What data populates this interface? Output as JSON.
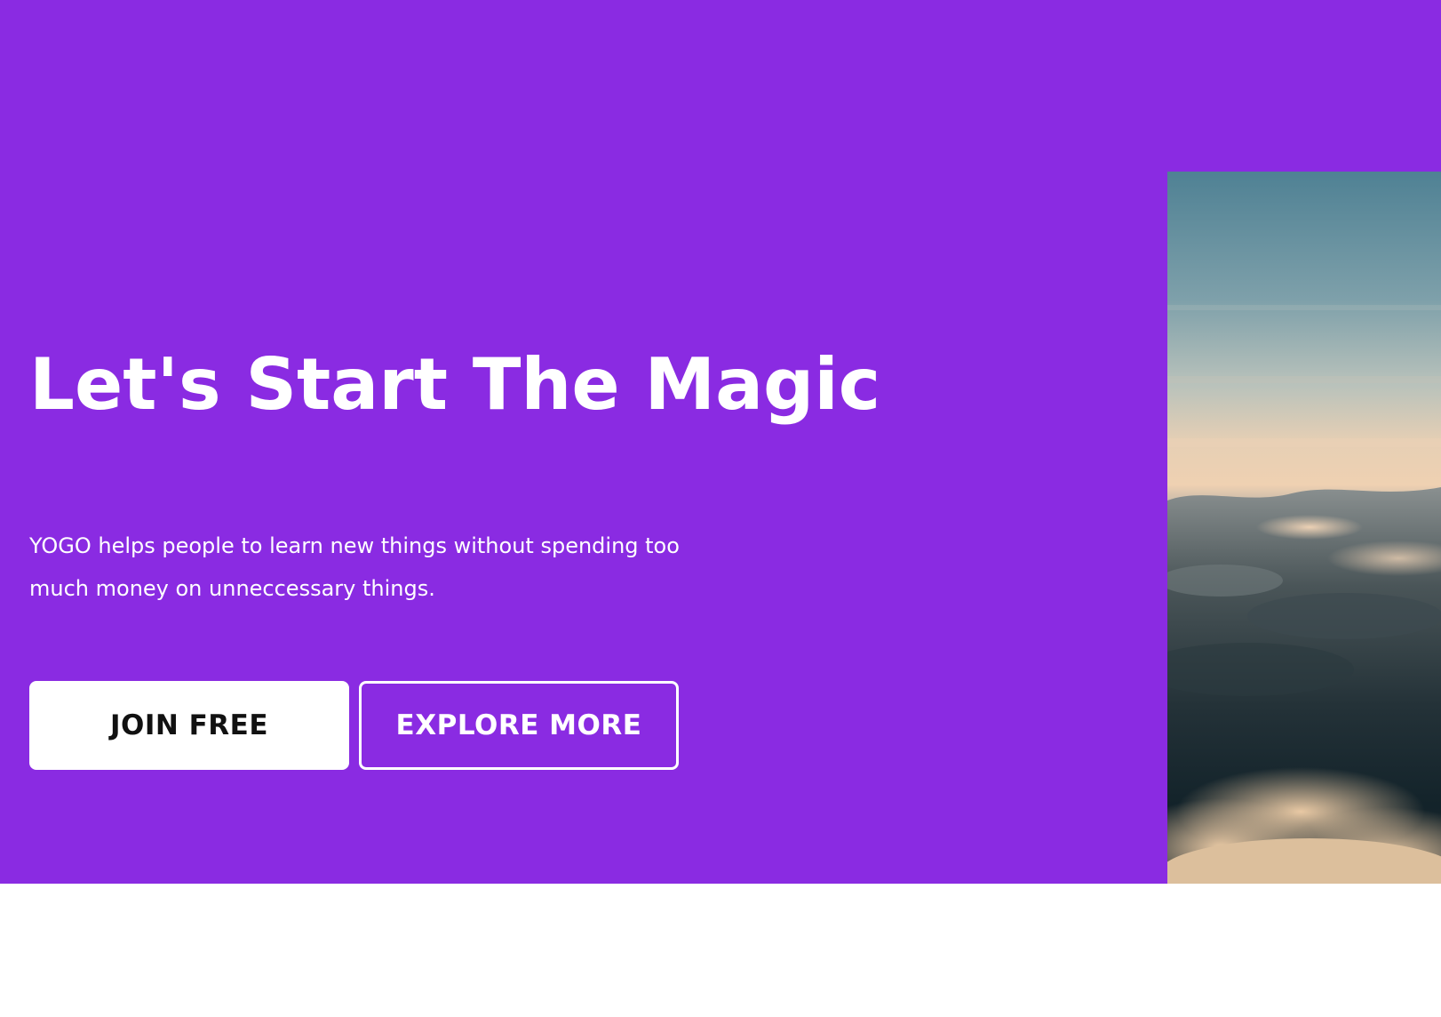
{
  "hero": {
    "title": "Let's Start The Magic",
    "description": "YOGO helps people to learn new things without spending too much money on unneccessary things.",
    "background_color": "#8a2be2",
    "buttons": {
      "join_label": "JOIN FREE",
      "explore_label": "EXPLORE MORE"
    },
    "image": {
      "icon": "clouds-sky-photo"
    }
  }
}
